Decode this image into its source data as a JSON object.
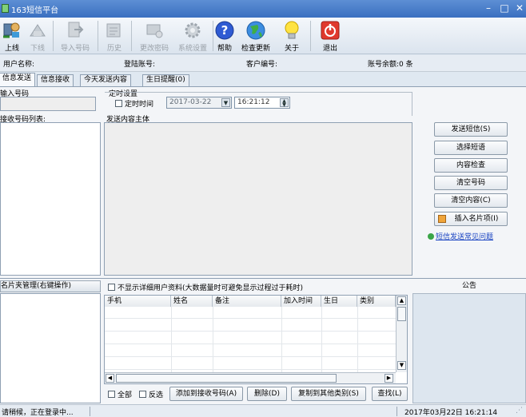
{
  "window": {
    "title": "163短信平台"
  },
  "toolbar": {
    "items": [
      {
        "label": "上线"
      },
      {
        "label": "下线"
      },
      {
        "label": "导入号码"
      },
      {
        "label": "历史"
      },
      {
        "label": "更改密码"
      },
      {
        "label": "系统设置"
      },
      {
        "label": "帮助"
      },
      {
        "label": "检查更新"
      },
      {
        "label": "关于"
      },
      {
        "label": "退出"
      }
    ]
  },
  "info": {
    "username_label": "用户名称:",
    "login_account_label": "登陆账号:",
    "customer_no_label": "客户编号:",
    "balance_label": "账号余额:0 条"
  },
  "tabs": [
    "信息发送",
    "信息接收",
    "今天发送内容",
    "生日提醒(0)"
  ],
  "send": {
    "input_number_label": "输入号码",
    "schedule_title": "定时设置",
    "schedule_checkbox": "定时时间",
    "date_value": "2017-03-22",
    "time_value": "16:21:12",
    "recipients_label": "接收号码列表:",
    "content_label": "发送内容主体",
    "buttons": {
      "send": "发送短信(S)",
      "select_template": "选择短语",
      "content_check": "内容检查",
      "clear_numbers": "清空号码",
      "clear_content": "清空内容(C)",
      "insert_card": "插入名片项(I)"
    },
    "faq_link": "短信发送常见问题"
  },
  "contacts": {
    "folder_label": "名片夹管理(右键操作)",
    "detail_checkbox": "不显示详细用户资料(大数据量时可避免显示过程过于耗时)",
    "columns": [
      "手机",
      "姓名",
      "备注",
      "加入时间",
      "生日",
      "类别"
    ],
    "select_all": "全部",
    "invert": "反选",
    "add_btn": "添加到接收号码(A)",
    "delete_btn": "删除(D)",
    "copy_btn": "复制到其他类别(S)",
    "find_btn": "查找(L)"
  },
  "notice": {
    "title": "公告"
  },
  "status": {
    "message": "请稍候，正在登录中...",
    "datetime": "2017年03月22日 16:21:14"
  }
}
